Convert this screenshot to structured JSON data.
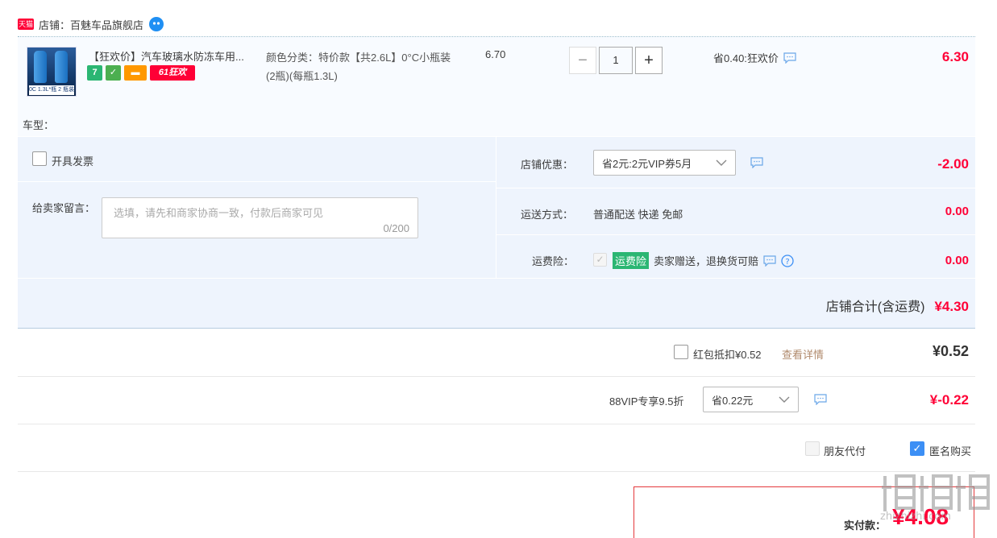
{
  "shop": {
    "badge": "天猫",
    "label": "店铺：百魅车品旗舰店"
  },
  "item": {
    "title": "【狂欢价】汽车玻璃水防冻车用...",
    "thumb_label": "0C 1.3L*瓶 2 瓶装",
    "promo_icons": {
      "seven": "7",
      "guarantee": "✓",
      "card": "▬",
      "sale": "61狂欢"
    },
    "sku": "颜色分类：特价款【共2.6L】0&deg;C小瓶装(2瓶)(每瓶1.3L)",
    "unit_price": "6.70",
    "quantity": "1",
    "minus": "−",
    "plus": "+",
    "save_text": "省0.40:狂欢价",
    "total": "6.30",
    "car_type": "车型："
  },
  "options": {
    "invoice_label": "开具发票",
    "memo_label": "给卖家留言：",
    "memo_placeholder": "选填，请先和商家协商一致，付款后商家可见",
    "memo_count": "0/200",
    "shop_discount_label": "店铺优惠：",
    "shop_discount_value": "省2元:2元VIP券5月",
    "shop_discount_amount": "-2.00",
    "shipping_label": "运送方式：",
    "shipping_value": "普通配送 快递 免邮",
    "shipping_amount": "0.00",
    "insurance_label": "运费险：",
    "insurance_badge": "运费险",
    "insurance_text": "卖家赠送，退换货可赔",
    "insurance_amount": "0.00",
    "shop_total_label": "店铺合计(含运费)",
    "shop_total_value": "¥4.30"
  },
  "redpacket": {
    "label": "红包抵扣¥0.52",
    "detail_link": "查看详情",
    "amount": "¥0.52"
  },
  "vip": {
    "label": "88VIP专享9.5折",
    "select_value": "省0.22元",
    "amount": "¥-0.22"
  },
  "pay_options": {
    "friend_pay": "朋友代付",
    "anonymous": "匿名购买"
  },
  "final": {
    "label": "实付款：",
    "amount": "¥4.08"
  },
  "watermark": "值什么值得买 zhi zhi zhi .com",
  "colors": {
    "accent_red": "#ff0036",
    "select_blue": "#3c8ff5",
    "panel_bg": "#eef4fd"
  }
}
